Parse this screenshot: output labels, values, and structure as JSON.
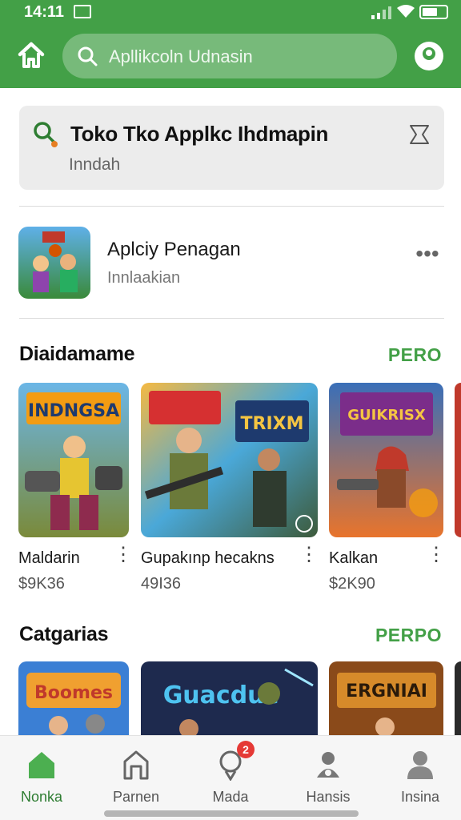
{
  "status_bar": {
    "time": "14:11"
  },
  "search": {
    "placeholder": "Apllikcoln Udnasin"
  },
  "promo": {
    "title": "Toko Tko Applkc Ihdmapin",
    "subtitle": "Inndah"
  },
  "featured_app": {
    "name": "Aplciy Penagan",
    "subtitle": "Innlaakian"
  },
  "section1": {
    "title": "Diaidamame",
    "more_label": "PERO",
    "cards": [
      {
        "name": "Maldarin",
        "price": "$9K36",
        "art_text": "INDNGSA"
      },
      {
        "name": "Gupakınp hecakns",
        "price": "49I36",
        "art_text": "TRIXM"
      },
      {
        "name": "Kalkan",
        "price": "$2K90",
        "art_text": "GUIKRISX"
      }
    ]
  },
  "section2": {
    "title": "Catgarias",
    "more_label": "PERPO",
    "cards": [
      {
        "art_text": "Boomes"
      },
      {
        "art_text": "Guacduc"
      },
      {
        "art_text": "ERGNIAI"
      }
    ]
  },
  "bottom_nav": {
    "items": [
      {
        "label": "Nonka",
        "icon": "home-icon",
        "active": true
      },
      {
        "label": "Parnen",
        "icon": "apps-icon"
      },
      {
        "label": "Mada",
        "icon": "bulb-icon",
        "badge": "2"
      },
      {
        "label": "Hansis",
        "icon": "person-badge-icon"
      },
      {
        "label": "Insina",
        "icon": "account-icon"
      }
    ]
  },
  "colors": {
    "primary": "#43a047",
    "accent": "#2e7d32",
    "badge": "#e53935"
  }
}
